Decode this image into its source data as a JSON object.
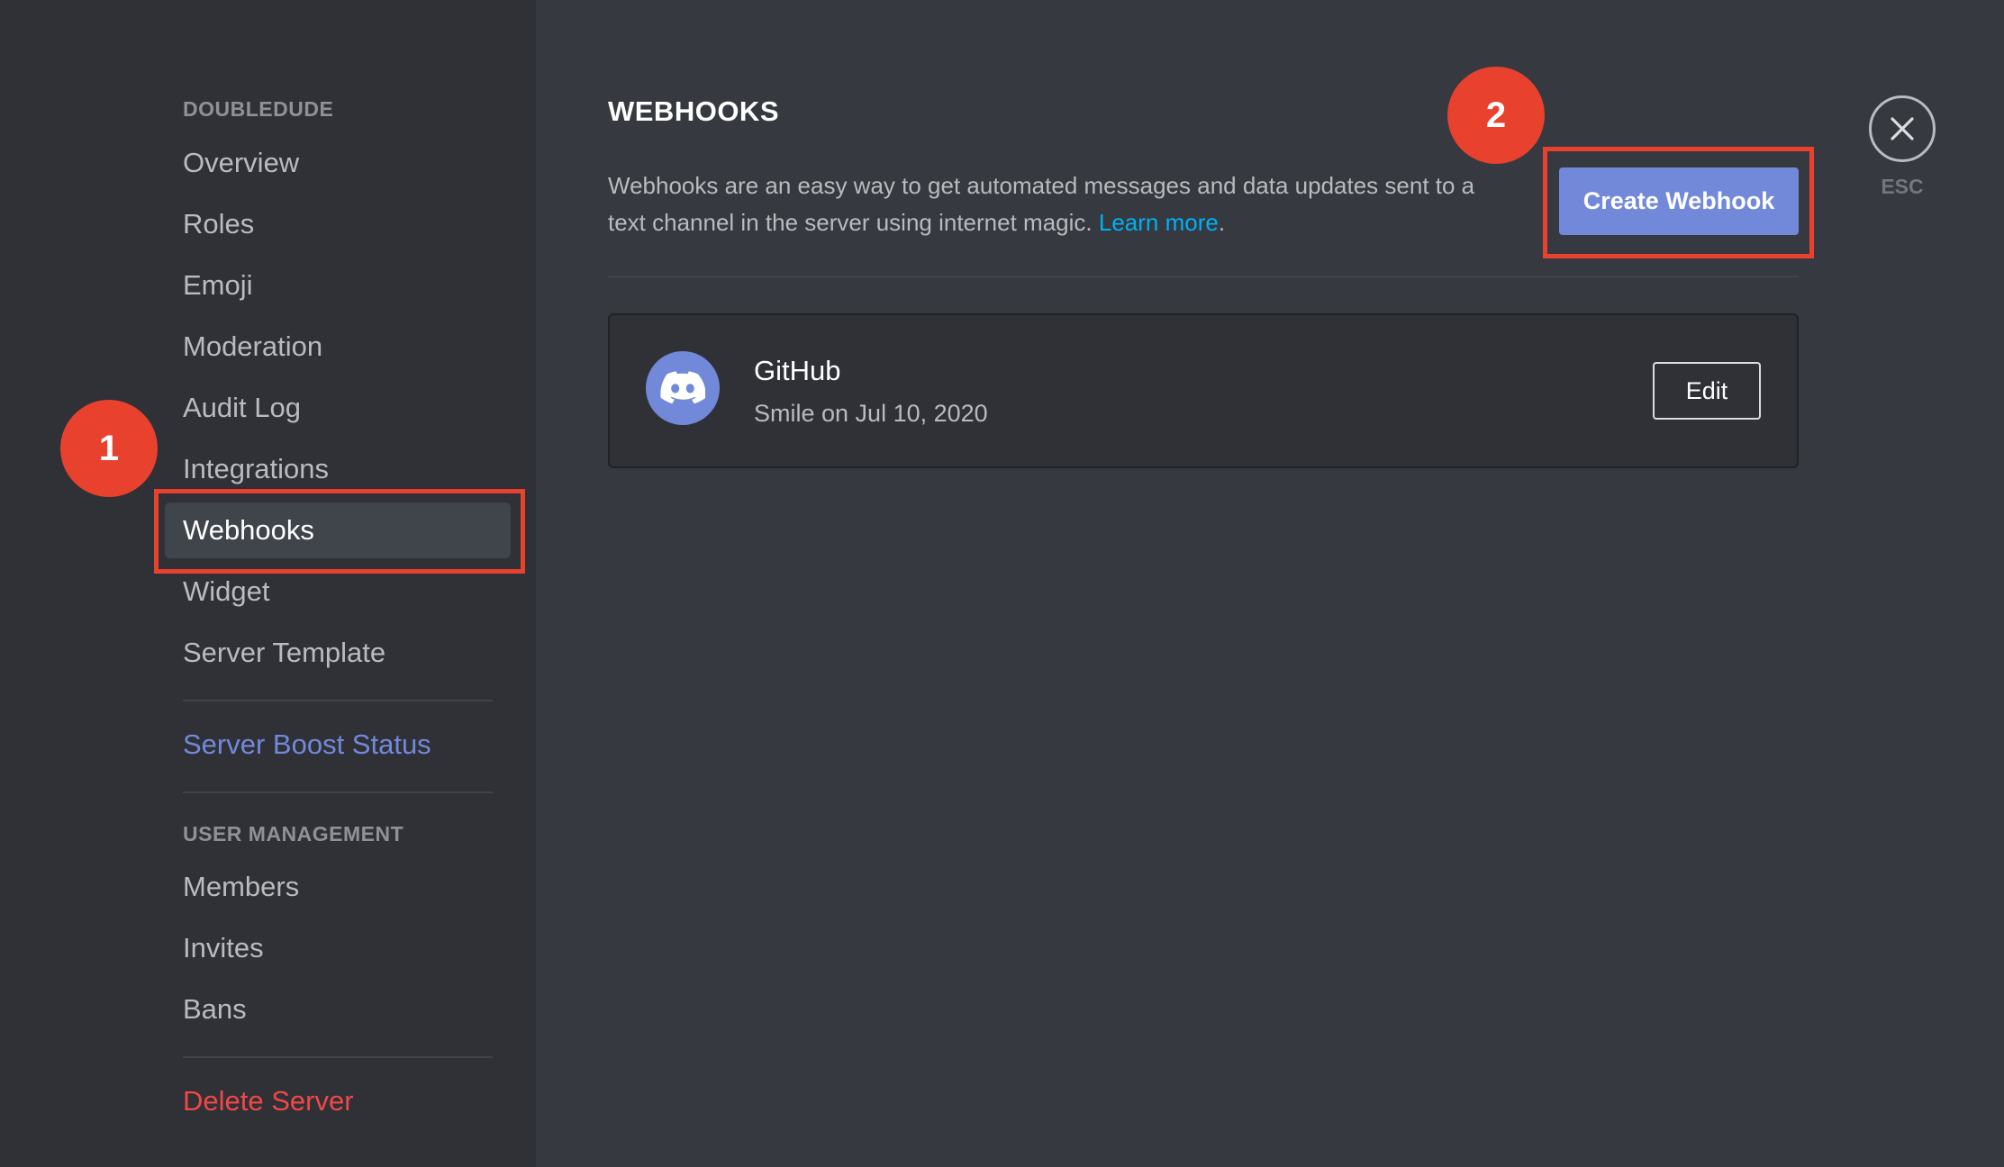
{
  "sidebar": {
    "server_header": "DOUBLEDUDE",
    "items": [
      {
        "label": "Overview"
      },
      {
        "label": "Roles"
      },
      {
        "label": "Emoji"
      },
      {
        "label": "Moderation"
      },
      {
        "label": "Audit Log"
      },
      {
        "label": "Integrations"
      },
      {
        "label": "Webhooks"
      },
      {
        "label": "Widget"
      },
      {
        "label": "Server Template"
      }
    ],
    "boost_label": "Server Boost Status",
    "user_mgmt_header": "USER MANAGEMENT",
    "user_items": [
      {
        "label": "Members"
      },
      {
        "label": "Invites"
      },
      {
        "label": "Bans"
      }
    ],
    "delete_label": "Delete Server"
  },
  "main": {
    "title": "WEBHOOKS",
    "description": "Webhooks are an easy way to get automated messages and data updates sent to a text channel in the server using internet magic.",
    "learn_more": "Learn more",
    "create_button": "Create Webhook",
    "webhooks": [
      {
        "name": "GitHub",
        "meta": "Smile on Jul 10, 2020",
        "edit_label": "Edit",
        "avatar_icon": "discord-logo-icon"
      }
    ]
  },
  "close": {
    "icon": "close-icon",
    "label": "ESC"
  },
  "annotations": {
    "badge_1": "1",
    "badge_2": "2",
    "color": "#e8412d"
  },
  "colors": {
    "accent": "#7289da",
    "danger": "#f04747",
    "link": "#00b0f4"
  }
}
